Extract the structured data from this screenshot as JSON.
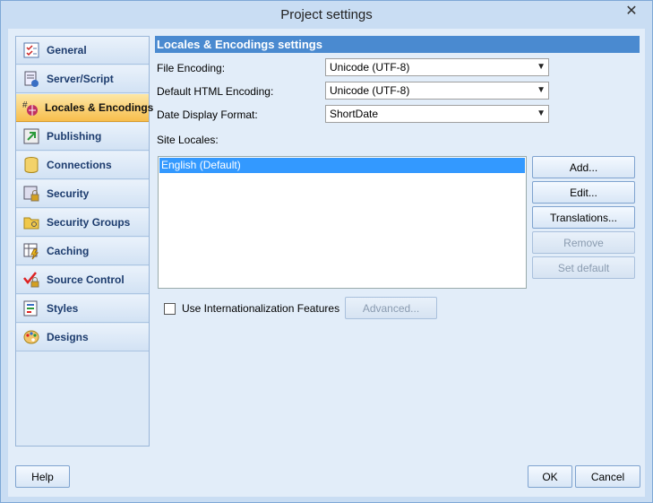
{
  "window": {
    "title": "Project settings"
  },
  "sidebar": {
    "items": [
      {
        "label": "General",
        "icon": "checklist-icon"
      },
      {
        "label": "Server/Script",
        "icon": "server-script-icon"
      },
      {
        "label": "Locales & Encodings",
        "icon": "locales-icon"
      },
      {
        "label": "Publishing",
        "icon": "publishing-icon"
      },
      {
        "label": "Connections",
        "icon": "database-icon"
      },
      {
        "label": "Security",
        "icon": "security-icon"
      },
      {
        "label": "Security Groups",
        "icon": "folder-key-icon"
      },
      {
        "label": "Caching",
        "icon": "caching-icon"
      },
      {
        "label": "Source Control",
        "icon": "source-control-icon"
      },
      {
        "label": "Styles",
        "icon": "styles-icon"
      },
      {
        "label": "Designs",
        "icon": "palette-icon"
      }
    ],
    "active_index": 2
  },
  "content": {
    "header": "Locales & Encodings settings",
    "file_encoding": {
      "label": "File Encoding:",
      "value": "Unicode (UTF-8)"
    },
    "html_encoding": {
      "label": "Default HTML Encoding:",
      "value": "Unicode (UTF-8)"
    },
    "date_format": {
      "label": "Date Display Format:",
      "value": "ShortDate"
    },
    "site_locales_label": "Site Locales:",
    "locales": [
      "English (Default)"
    ],
    "buttons": {
      "add": "Add...",
      "edit": "Edit...",
      "translations": "Translations...",
      "remove": "Remove",
      "set_default": "Set default"
    },
    "intl_checkbox": {
      "label": "Use Internationalization Features",
      "checked": false
    },
    "advanced": "Advanced..."
  },
  "footer": {
    "help": "Help",
    "ok": "OK",
    "cancel": "Cancel"
  },
  "colors": {
    "accent": "#4a8ad0",
    "active_nav": "#f7be4c",
    "selection": "#3399ff"
  }
}
